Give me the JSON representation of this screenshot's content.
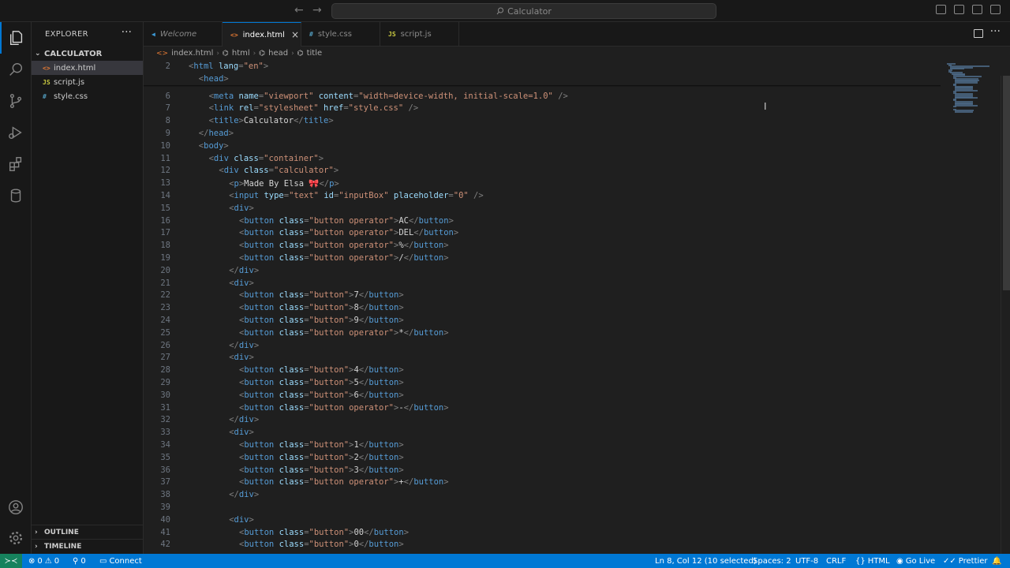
{
  "titlebar": {
    "search_text": "Calculator"
  },
  "sidebar": {
    "title": "EXPLORER",
    "folder": "CALCULATOR",
    "files": [
      {
        "name": "index.html",
        "type": "html",
        "active": true
      },
      {
        "name": "script.js",
        "type": "js",
        "active": false
      },
      {
        "name": "style.css",
        "type": "css",
        "active": false
      }
    ],
    "outline": "OUTLINE",
    "timeline": "TIMELINE"
  },
  "tabs": [
    {
      "label": "Welcome",
      "icon": "vscode-icon",
      "active": false
    },
    {
      "label": "index.html",
      "icon": "html-icon",
      "active": true
    },
    {
      "label": "style.css",
      "icon": "css-icon",
      "active": false
    },
    {
      "label": "script.js",
      "icon": "js-icon",
      "active": false
    }
  ],
  "breadcrumb": [
    "index.html",
    "html",
    "head",
    "title"
  ],
  "code_lines": [
    {
      "n": "2",
      "indent": 0,
      "html": "&lt;html lang=\"en\"&gt;"
    },
    {
      "n": "",
      "indent": 1,
      "html": "&lt;head&gt;"
    },
    {
      "n": "6",
      "indent": 2,
      "html": "&lt;meta name=\"viewport\" content=\"width=device-width, initial-scale=1.0\" /&gt;"
    },
    {
      "n": "7",
      "indent": 2,
      "html": "&lt;link rel=\"stylesheet\" href=\"style.css\" /&gt;"
    },
    {
      "n": "8",
      "indent": 2,
      "html": "&lt;title&gt;Calculator&lt;/title&gt;"
    },
    {
      "n": "9",
      "indent": 1,
      "html": "&lt;/head&gt;"
    },
    {
      "n": "10",
      "indent": 1,
      "html": "&lt;body&gt;"
    },
    {
      "n": "11",
      "indent": 2,
      "html": "&lt;div class=\"container\"&gt;"
    },
    {
      "n": "12",
      "indent": 3,
      "html": "&lt;div class=\"calculator\"&gt;"
    },
    {
      "n": "13",
      "indent": 4,
      "html": "&lt;p&gt;Made By Elsa 🎀&lt;/p&gt;"
    },
    {
      "n": "14",
      "indent": 4,
      "html": "&lt;input type=\"text\" id=\"inputBox\" placeholder=\"0\" /&gt;"
    },
    {
      "n": "15",
      "indent": 4,
      "html": "&lt;div&gt;"
    },
    {
      "n": "16",
      "indent": 5,
      "html": "&lt;button class=\"button operator\"&gt;AC&lt;/button&gt;"
    },
    {
      "n": "17",
      "indent": 5,
      "html": "&lt;button class=\"button operator\"&gt;DEL&lt;/button&gt;"
    },
    {
      "n": "18",
      "indent": 5,
      "html": "&lt;button class=\"button operator\"&gt;%&lt;/button&gt;"
    },
    {
      "n": "19",
      "indent": 5,
      "html": "&lt;button class=\"button operator\"&gt;/&lt;/button&gt;"
    },
    {
      "n": "20",
      "indent": 4,
      "html": "&lt;/div&gt;"
    },
    {
      "n": "21",
      "indent": 4,
      "html": "&lt;div&gt;"
    },
    {
      "n": "22",
      "indent": 5,
      "html": "&lt;button class=\"button\"&gt;7&lt;/button&gt;"
    },
    {
      "n": "23",
      "indent": 5,
      "html": "&lt;button class=\"button\"&gt;8&lt;/button&gt;"
    },
    {
      "n": "24",
      "indent": 5,
      "html": "&lt;button class=\"button\"&gt;9&lt;/button&gt;"
    },
    {
      "n": "25",
      "indent": 5,
      "html": "&lt;button class=\"button operator\"&gt;*&lt;/button&gt;"
    },
    {
      "n": "26",
      "indent": 4,
      "html": "&lt;/div&gt;"
    },
    {
      "n": "27",
      "indent": 4,
      "html": "&lt;div&gt;"
    },
    {
      "n": "28",
      "indent": 5,
      "html": "&lt;button class=\"button\"&gt;4&lt;/button&gt;"
    },
    {
      "n": "29",
      "indent": 5,
      "html": "&lt;button class=\"button\"&gt;5&lt;/button&gt;"
    },
    {
      "n": "30",
      "indent": 5,
      "html": "&lt;button class=\"button\"&gt;6&lt;/button&gt;"
    },
    {
      "n": "31",
      "indent": 5,
      "html": "&lt;button class=\"button operator\"&gt;-&lt;/button&gt;"
    },
    {
      "n": "32",
      "indent": 4,
      "html": "&lt;/div&gt;"
    },
    {
      "n": "33",
      "indent": 4,
      "html": "&lt;div&gt;"
    },
    {
      "n": "34",
      "indent": 5,
      "html": "&lt;button class=\"button\"&gt;1&lt;/button&gt;"
    },
    {
      "n": "35",
      "indent": 5,
      "html": "&lt;button class=\"button\"&gt;2&lt;/button&gt;"
    },
    {
      "n": "36",
      "indent": 5,
      "html": "&lt;button class=\"button\"&gt;3&lt;/button&gt;"
    },
    {
      "n": "37",
      "indent": 5,
      "html": "&lt;button class=\"button operator\"&gt;+&lt;/button&gt;"
    },
    {
      "n": "38",
      "indent": 4,
      "html": "&lt;/div&gt;"
    },
    {
      "n": "39",
      "indent": 0,
      "html": ""
    },
    {
      "n": "40",
      "indent": 4,
      "html": "&lt;div&gt;"
    },
    {
      "n": "41",
      "indent": 5,
      "html": "&lt;button class=\"button\"&gt;00&lt;/button&gt;"
    },
    {
      "n": "42",
      "indent": 5,
      "html": "&lt;button class=\"button\"&gt;0&lt;/button&gt;"
    }
  ],
  "status": {
    "remote": "",
    "errors": "0",
    "warnings": "0",
    "ports": "0",
    "connect": "Connect",
    "position": "Ln 8, Col 12 (10 selected)",
    "spaces": "Spaces: 2",
    "encoding": "UTF-8",
    "eol": "CRLF",
    "language": "HTML",
    "golive": "Go Live",
    "prettier": "Prettier"
  },
  "colors": {
    "accent": "#0078d4",
    "remote": "#16825d",
    "tag": "#569cd6",
    "attr": "#9cdcfe",
    "string": "#ce9178"
  }
}
